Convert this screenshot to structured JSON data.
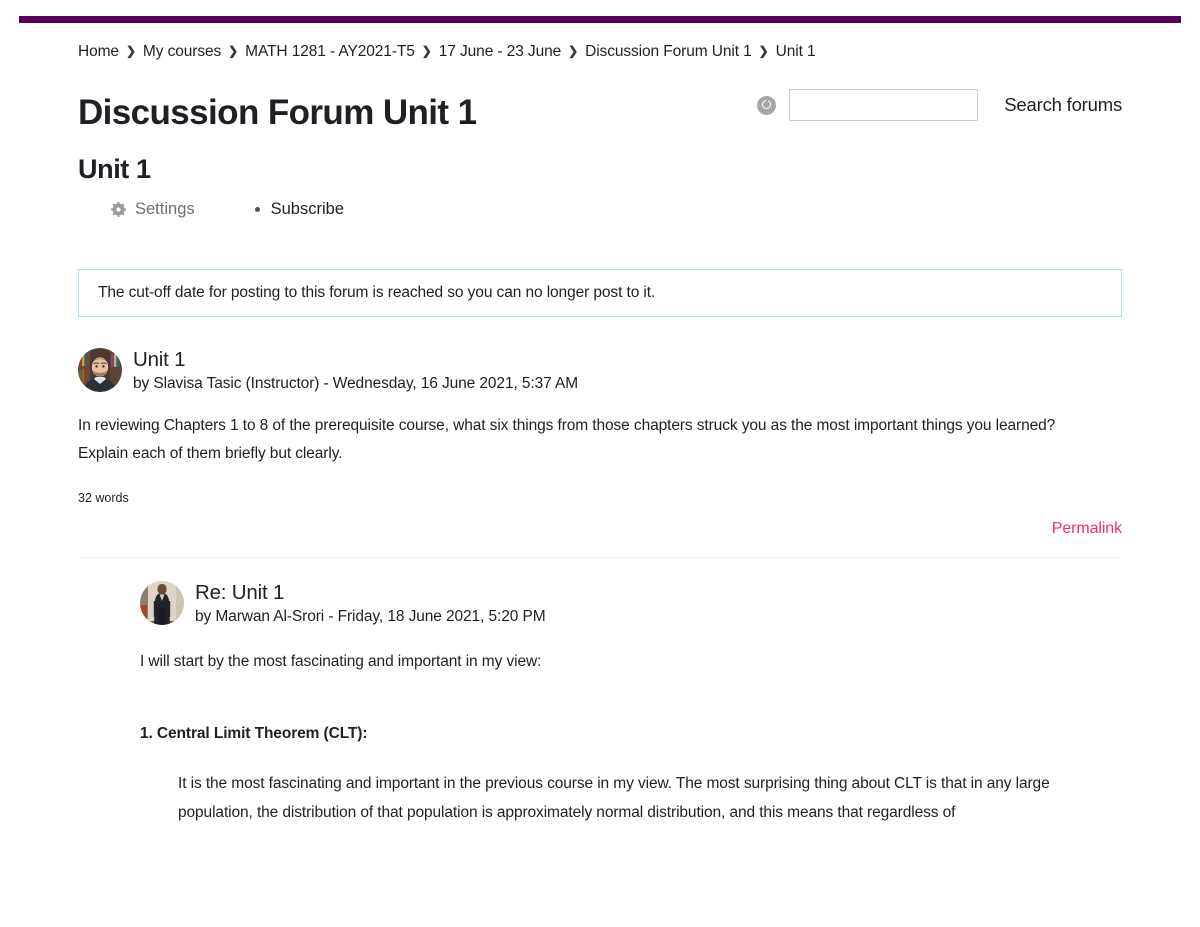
{
  "theme": {
    "accent_bar": "#56005a",
    "permalink_color": "#f72a6c",
    "notice_border": "#b5e0ef",
    "muted_text": "#6f6f6f"
  },
  "breadcrumb": {
    "separator": "❯",
    "items": [
      {
        "label": "Home"
      },
      {
        "label": "My courses"
      },
      {
        "label": "MATH 1281 - AY2021-T5"
      },
      {
        "label": "17 June - 23 June"
      },
      {
        "label": "Discussion Forum Unit 1"
      },
      {
        "label": "Unit 1"
      }
    ]
  },
  "search": {
    "icon": "help-circle-icon",
    "value": "",
    "placeholder": "",
    "label": "Search forums"
  },
  "header": {
    "page_title": "Discussion Forum Unit 1",
    "forum_title": "Unit 1"
  },
  "actions": [
    {
      "label": "Settings",
      "icon": "gear-icon"
    },
    {
      "label": "Subscribe",
      "icon": "bullet-dot-icon"
    }
  ],
  "notice": {
    "text": "The cut-off date for posting to this forum is reached so you can no longer post to it."
  },
  "posts": [
    {
      "subject": "Unit 1",
      "meta": "by Slavisa Tasic (Instructor) - Wednesday, 16 June 2021, 5:37 AM",
      "author": "Slavisa Tasic",
      "role": "Instructor",
      "date": "Wednesday, 16 June 2021, 5:37 AM",
      "avatar": "instructor-avatar",
      "body": "In reviewing Chapters 1 to 8 of the prerequisite course, what six things from those chapters struck you as the most important things you learned? Explain each of them briefly but clearly.",
      "wordcount": "32 words",
      "permalink_label": "Permalink"
    },
    {
      "subject": "Re: Unit 1",
      "meta": "by Marwan Al-Srori - Friday, 18 June 2021, 5:20 PM",
      "author": "Marwan Al-Srori",
      "date": "Friday, 18 June 2021, 5:20 PM",
      "avatar": "student-avatar",
      "lead": "I will start by the most fascinating and important in my view:",
      "item_title": "1. Central Limit Theorem (CLT):",
      "item_text": "It is the most fascinating and important in the previous course in my view. The most surprising thing about CLT is that in any large population, the distribution of that population is approximately normal distribution, and this means that regardless of"
    }
  ]
}
